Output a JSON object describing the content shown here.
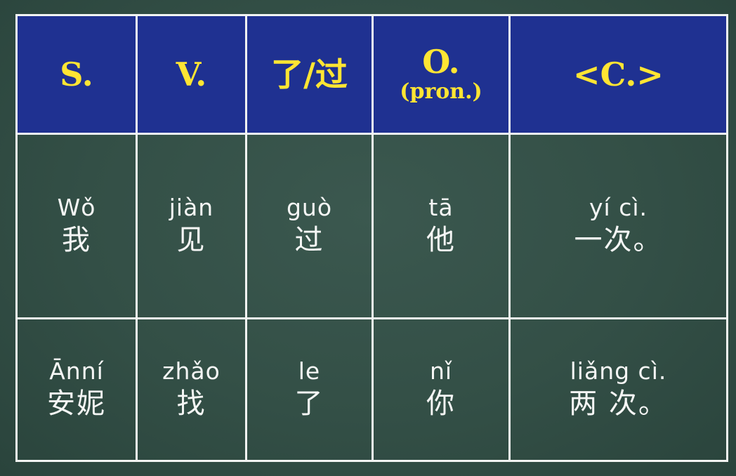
{
  "header": [
    {
      "main": "S.",
      "sub": ""
    },
    {
      "main": "V.",
      "sub": ""
    },
    {
      "main": "了/过",
      "sub": ""
    },
    {
      "main": "O.",
      "sub": "(pron.)"
    },
    {
      "main": "<C.>",
      "sub": ""
    }
  ],
  "rows": [
    {
      "cells": [
        {
          "pinyin": "Wǒ",
          "hanzi": "我"
        },
        {
          "pinyin": "jiàn",
          "hanzi": "见"
        },
        {
          "pinyin": "guò",
          "hanzi": "过"
        },
        {
          "pinyin": "tā",
          "hanzi": "他"
        },
        {
          "pinyin": "yí cì.",
          "hanzi": "一次。"
        }
      ]
    },
    {
      "cells": [
        {
          "pinyin": "Ānní",
          "hanzi": "安妮"
        },
        {
          "pinyin": "zhǎo",
          "hanzi": "找"
        },
        {
          "pinyin": "le",
          "hanzi": "了"
        },
        {
          "pinyin": "nǐ",
          "hanzi": "你"
        },
        {
          "pinyin": "liǎng cì.",
          "hanzi": "两 次。"
        }
      ]
    }
  ],
  "colors": {
    "board": "#334f46",
    "header_bg": "#1f3191",
    "header_text": "#ffe533",
    "grid_line": "#f2f4f2",
    "body_text": "#f5f6f5"
  }
}
